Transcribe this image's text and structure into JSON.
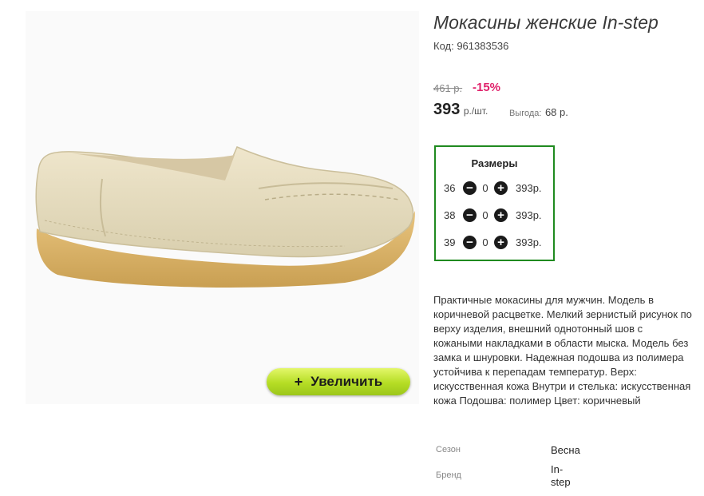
{
  "product": {
    "title": "Мокасины женские In-step",
    "sku": "Код: 961383536",
    "old_price": "461 р.",
    "discount": "-15%",
    "price": "393",
    "price_unit": "р./шт.",
    "savings_label": "Выгода:",
    "savings_value": "68 р."
  },
  "zoom_button": {
    "icon": "plus-icon",
    "label": "Увеличить"
  },
  "sizes": {
    "title": "Размеры",
    "rows": [
      {
        "size": "36",
        "qty": "0",
        "price": "393р."
      },
      {
        "size": "38",
        "qty": "0",
        "price": "393р."
      },
      {
        "size": "39",
        "qty": "0",
        "price": "393р."
      }
    ]
  },
  "description": "Практичные мокасины для мужчин. Модель в коричневой расцветке. Мелкий зернистый рисунок по верху изделия, внешний однотонный шов с кожаными накладками в области мыска. Модель без замка и шнуровки. Надежная подошва из полимера устойчива к перепадам температур. Верх: искусственная кожа Внутри и стелька: искусственная кожа Подошва: полимер Цвет: коричневый",
  "specs": [
    {
      "label": "Сезон",
      "value": "Весна"
    },
    {
      "label": "Бренд",
      "value_line1": "In-",
      "value_line2": "step"
    }
  ],
  "colors": {
    "border_green": "#1f8a1f",
    "discount": "#e0226b",
    "button": "#b5dd24"
  }
}
